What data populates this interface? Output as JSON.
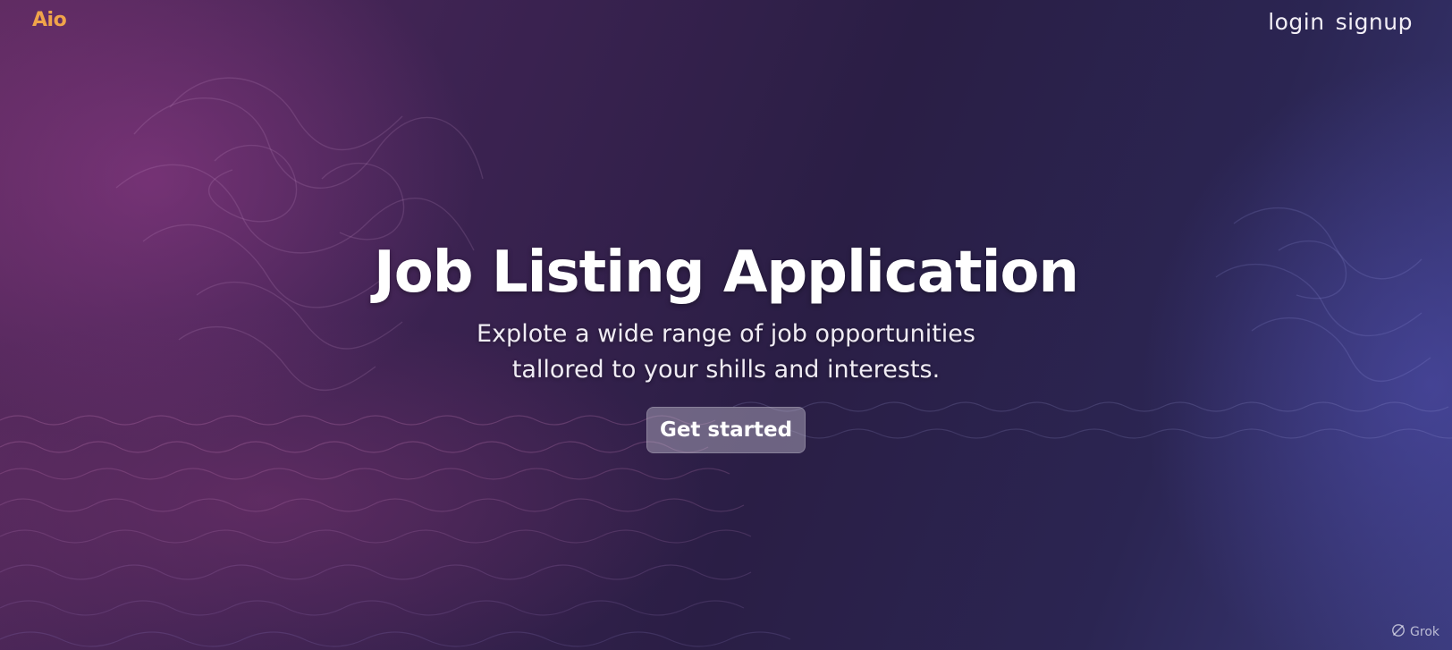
{
  "brand": {
    "logo_text": "Aio"
  },
  "nav": {
    "login_label": "login",
    "signup_label": "signup"
  },
  "hero": {
    "title": "Job Listing Application",
    "subtitle_line1": "Explote a wide range of job opportunities",
    "subtitle_line2": "tallored to your shills and interests.",
    "cta_label": "Get started"
  },
  "watermark": {
    "text": "Grok",
    "icon": "grok-logo-icon"
  },
  "colors": {
    "brand": "#f0a44a",
    "text": "#ffffff",
    "background_left": "#5a2a5e",
    "background_mid": "#2a1e45",
    "background_right": "#3a3a7a"
  }
}
